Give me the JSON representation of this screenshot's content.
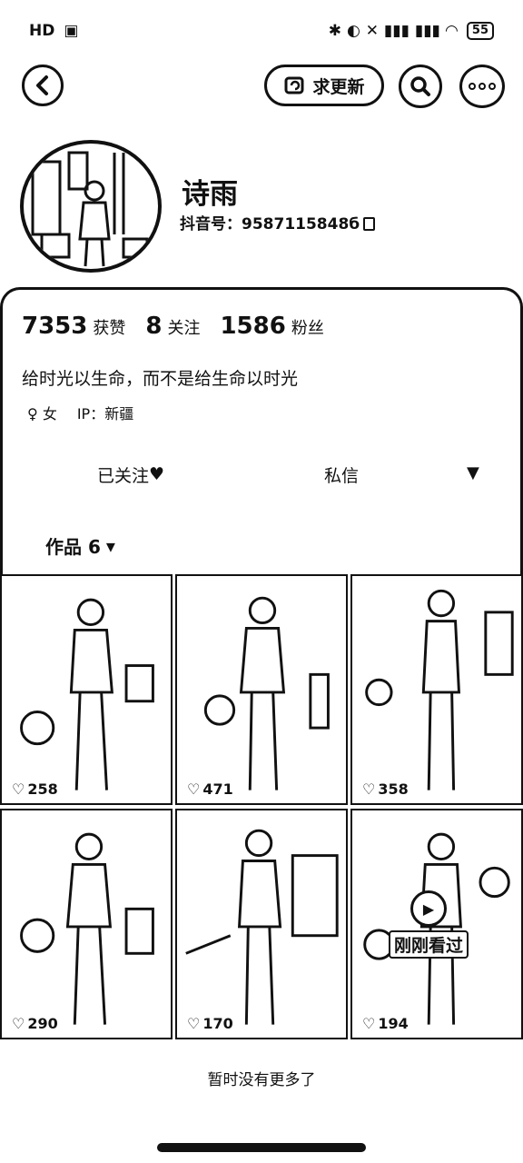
{
  "status_bar": {
    "carrier": "HD",
    "right_icons": "✱ ◐ ✕ ▮▮▮ ▮▮▮ ◠",
    "battery": "55"
  },
  "nav": {
    "back_icon": "chevron-left",
    "update_label": "求更新",
    "search_icon": "search",
    "more_icon": "more-dots"
  },
  "profile": {
    "username": "诗雨",
    "account_label": "抖音号：",
    "account_id": "9587115848б"
  },
  "stats": [
    {
      "value": "7353",
      "label": "获赞"
    },
    {
      "value": "8",
      "label": "关注"
    },
    {
      "value": "1586",
      "label": "粉丝"
    }
  ],
  "bio": "给时光以生命，而不是给生命以时光",
  "tags": {
    "gender": "女",
    "ip": "IP：新疆"
  },
  "actions": {
    "follow_label": "已关注",
    "message_label": "私信"
  },
  "works_tab": "作品 6",
  "videos": [
    {
      "likes": "258"
    },
    {
      "likes": "471"
    },
    {
      "likes": "358"
    },
    {
      "likes": "290"
    },
    {
      "likes": "170"
    },
    {
      "likes": "194",
      "badge": "刚刚看过"
    }
  ],
  "footer": "暂时没有更多了"
}
